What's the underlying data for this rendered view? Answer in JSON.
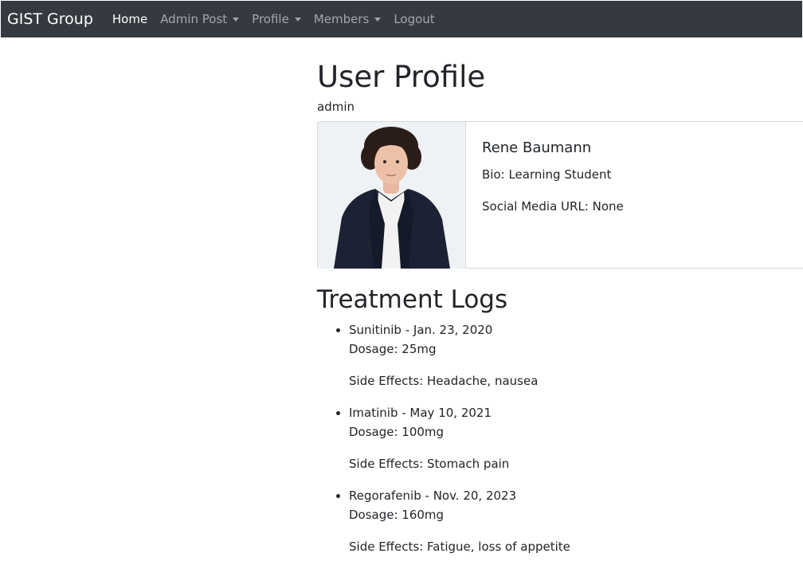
{
  "navbar": {
    "brand": "GIST Group",
    "items": [
      {
        "label": "Home",
        "active": true,
        "dropdown": false
      },
      {
        "label": "Admin Post",
        "active": false,
        "dropdown": true
      },
      {
        "label": "Profile",
        "active": false,
        "dropdown": true
      },
      {
        "label": "Members",
        "active": false,
        "dropdown": true
      },
      {
        "label": "Logout",
        "active": false,
        "dropdown": false
      }
    ]
  },
  "page": {
    "title": "User Profile",
    "username": "admin"
  },
  "profile_card": {
    "name": "Rene Baumann",
    "bio": "Bio: Learning Student",
    "social": "Social Media URL: None"
  },
  "treatment": {
    "title": "Treatment Logs",
    "logs": [
      {
        "heading": "Sunitinib - Jan. 23, 2020",
        "dosage": "Dosage: 25mg",
        "side_effects": "Side Effects: Headache, nausea"
      },
      {
        "heading": "Imatinib - May 10, 2021",
        "dosage": "Dosage: 100mg",
        "side_effects": "Side Effects: Stomach pain"
      },
      {
        "heading": "Regorafenib - Nov. 20, 2023",
        "dosage": "Dosage: 160mg",
        "side_effects": "Side Effects: Fatigue, loss of appetite"
      }
    ]
  },
  "colors": {
    "navbar_bg": "#343a40",
    "text": "#212529"
  }
}
